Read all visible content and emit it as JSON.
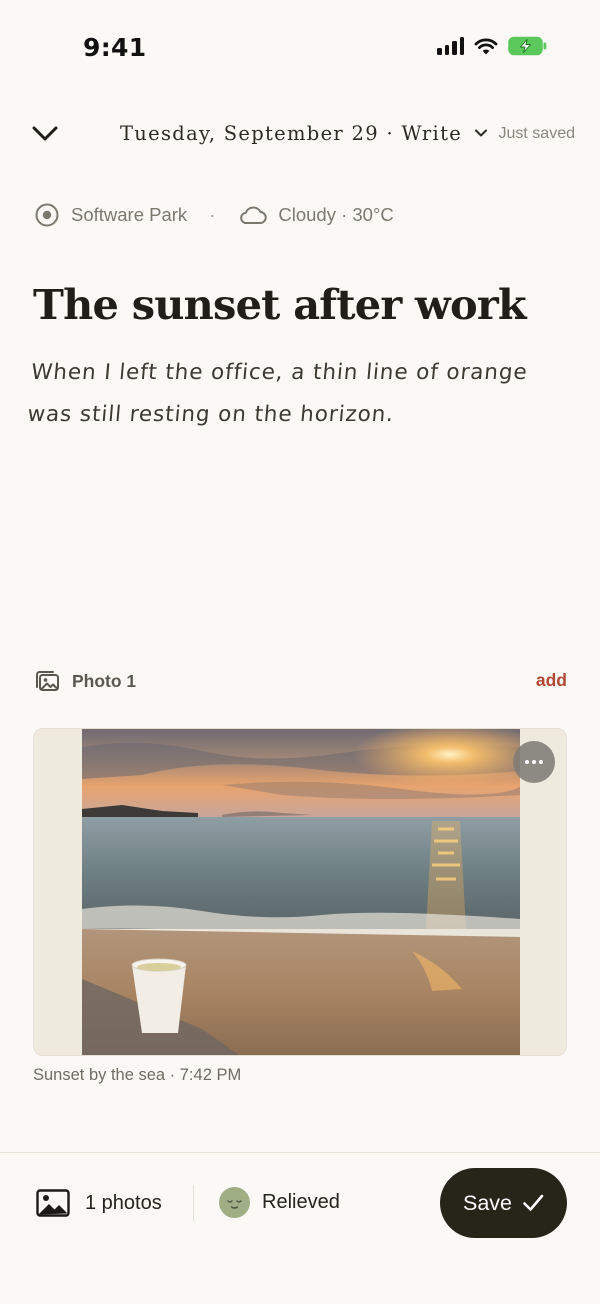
{
  "status_bar": {
    "time": "9:41",
    "icons": [
      "signal-icon",
      "wifi-icon",
      "battery-charging-icon"
    ],
    "battery_color": "#5ac85a"
  },
  "header": {
    "date": "Tuesday, September 29",
    "mode": "Write",
    "save_status": "Just saved",
    "icons": [
      "chevron-down-icon",
      "dropdown-caret-icon"
    ]
  },
  "meta": {
    "location": "Software Park",
    "separator": "·",
    "weather": "Cloudy · 30°C",
    "icons": [
      "location-target-icon",
      "cloud-icon"
    ]
  },
  "entry": {
    "title": "The sunset after work",
    "body_line1": "When I left the office, a thin line of orange",
    "body_line2": "was still resting on the horizon."
  },
  "photos_section": {
    "label": "Photo 1",
    "add_label": "add",
    "accent_color": "#b14834",
    "caption": "Sunset by the sea · 7:42 PM",
    "icons": [
      "photo-stack-icon",
      "more-options-icon"
    ]
  },
  "footer": {
    "photo_count_label": "1 photos",
    "mood_label": "Relieved",
    "save_label": "Save",
    "icons": [
      "image-icon",
      "mood-face-icon",
      "checkmark-icon"
    ],
    "save_bg": "#272419"
  }
}
